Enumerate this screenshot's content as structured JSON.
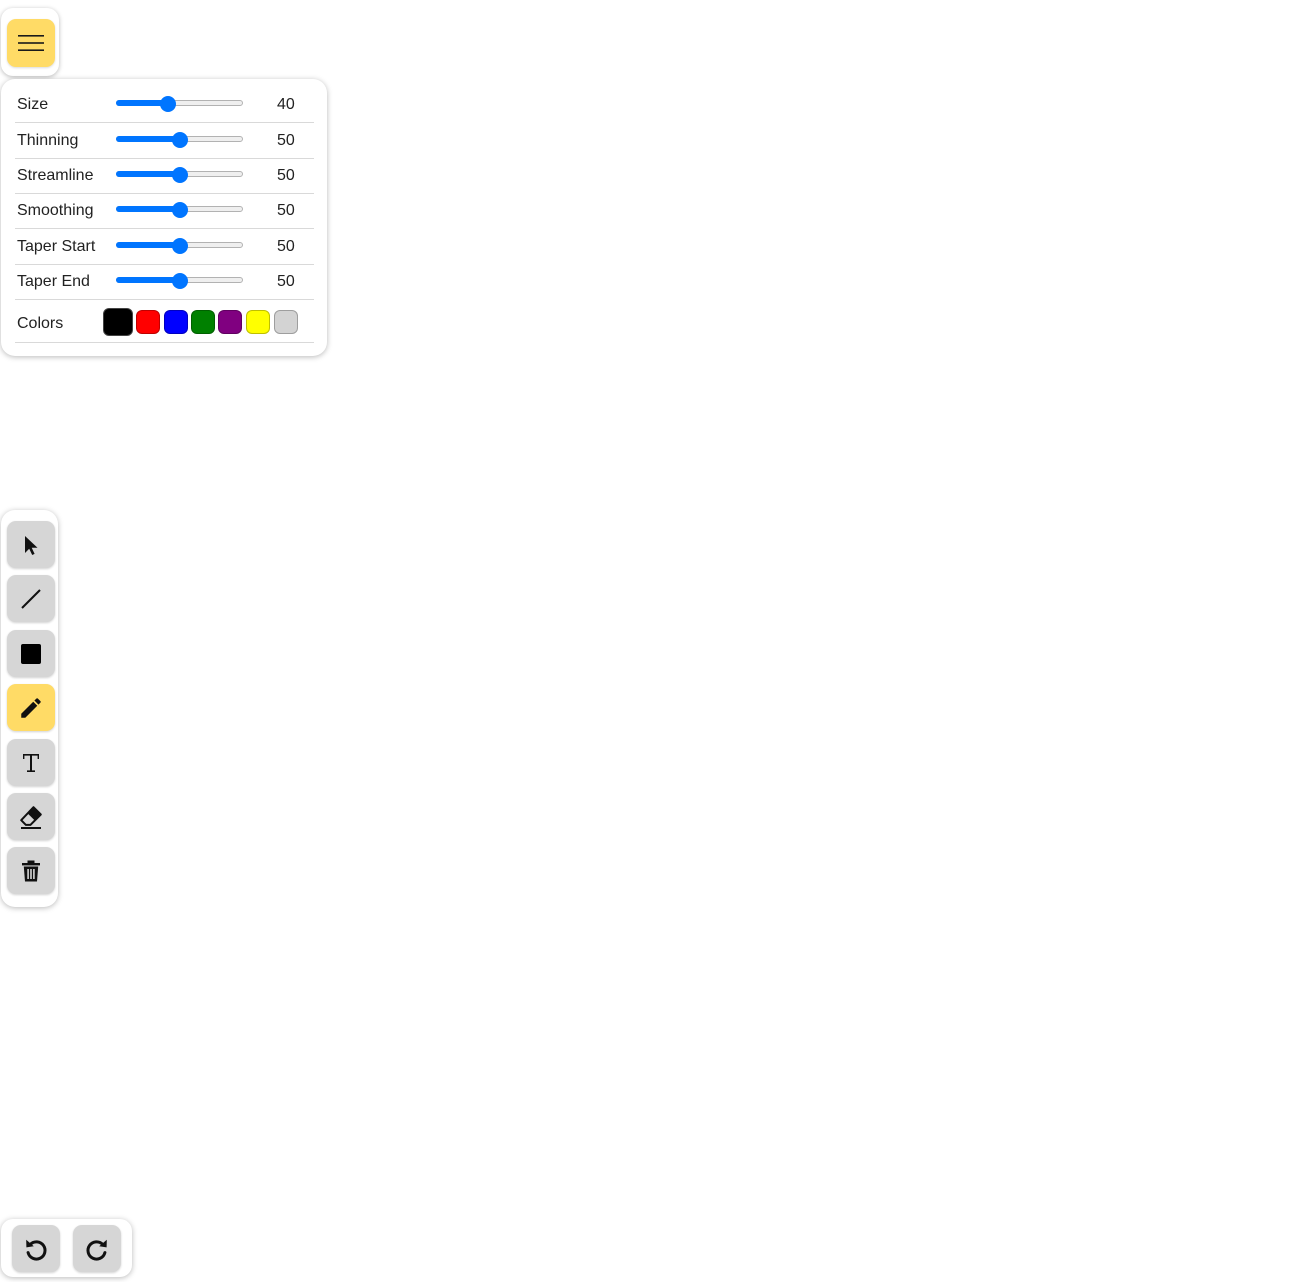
{
  "menu": {
    "icon": "hamburger-icon",
    "accent_color": "#ffdb66"
  },
  "settings": {
    "sliders": [
      {
        "key": "size",
        "label": "Size",
        "value": "40",
        "min": 0,
        "max": 100
      },
      {
        "key": "thinning",
        "label": "Thinning",
        "value": "50",
        "min": 0,
        "max": 100
      },
      {
        "key": "streamline",
        "label": "Streamline",
        "value": "50",
        "min": 0,
        "max": 100
      },
      {
        "key": "smoothing",
        "label": "Smoothing",
        "value": "50",
        "min": 0,
        "max": 100
      },
      {
        "key": "taper-start",
        "label": "Taper Start",
        "value": "50",
        "min": 0,
        "max": 100
      },
      {
        "key": "taper-end",
        "label": "Taper End",
        "value": "50",
        "min": 0,
        "max": 100
      }
    ],
    "colors_label": "Colors",
    "colors": [
      {
        "name": "black",
        "hex": "#000000",
        "selected": true
      },
      {
        "name": "red",
        "hex": "#ff0000",
        "selected": false
      },
      {
        "name": "blue",
        "hex": "#0000ff",
        "selected": false
      },
      {
        "name": "green",
        "hex": "#008000",
        "selected": false
      },
      {
        "name": "purple",
        "hex": "#800080",
        "selected": false
      },
      {
        "name": "yellow",
        "hex": "#ffff00",
        "selected": false
      },
      {
        "name": "lightgray",
        "hex": "#d3d3d3",
        "selected": false
      }
    ],
    "slider_accent": "#0075ff"
  },
  "tools": [
    {
      "key": "select",
      "icon": "cursor-arrow-icon",
      "active": false
    },
    {
      "key": "line",
      "icon": "line-icon",
      "active": false
    },
    {
      "key": "rectangle",
      "icon": "square-icon",
      "active": false
    },
    {
      "key": "pen",
      "icon": "pencil-icon",
      "active": true
    },
    {
      "key": "text",
      "icon": "text-icon",
      "active": false
    },
    {
      "key": "eraser",
      "icon": "eraser-icon",
      "active": false
    },
    {
      "key": "clear",
      "icon": "trash-icon",
      "active": false
    }
  ],
  "history": [
    {
      "key": "undo",
      "icon": "undo-icon"
    },
    {
      "key": "redo",
      "icon": "redo-icon"
    }
  ]
}
